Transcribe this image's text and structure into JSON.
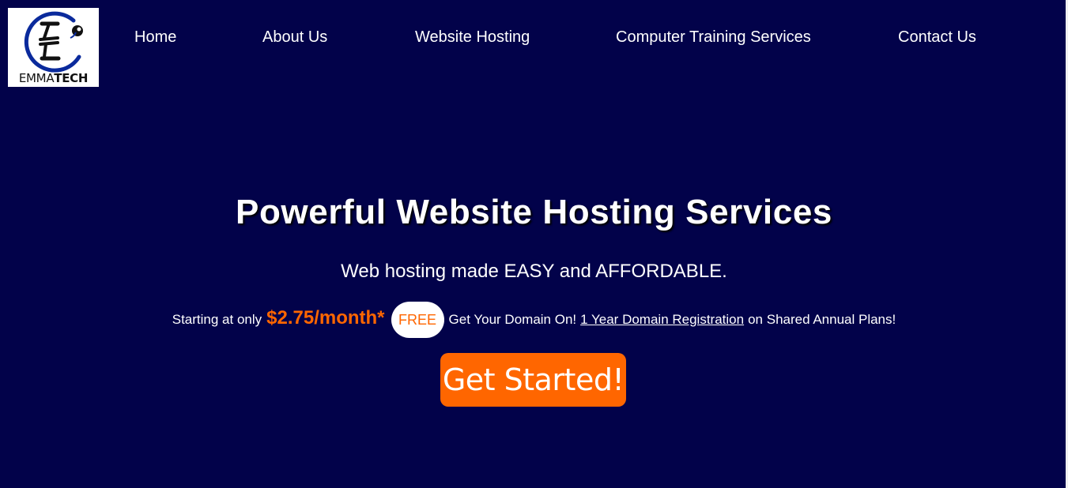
{
  "brand": {
    "logo_text_light": "EMMA",
    "logo_text_bold": "TECH",
    "logo_ring_color": "#0a2a9c"
  },
  "nav": {
    "items": [
      {
        "label": "Home"
      },
      {
        "label": "About Us"
      },
      {
        "label": "Website Hosting"
      },
      {
        "label": "Computer Training Services"
      },
      {
        "label": "Contact Us"
      }
    ]
  },
  "hero": {
    "title": "Powerful Website Hosting Services",
    "subtitle": "Web hosting made EASY and AFFORDABLE.",
    "offer": {
      "prefix": "Starting at only",
      "price": "$2.75/month*",
      "badge": "FREE",
      "text_before_link": "Get Your Domain On!",
      "link_text": "1 Year Domain Registration",
      "text_after_link": "on Shared Annual Plans!"
    },
    "cta_label": "Get Started!"
  },
  "colors": {
    "background": "#02024a",
    "accent": "#ff6600",
    "text": "#ffffff"
  }
}
